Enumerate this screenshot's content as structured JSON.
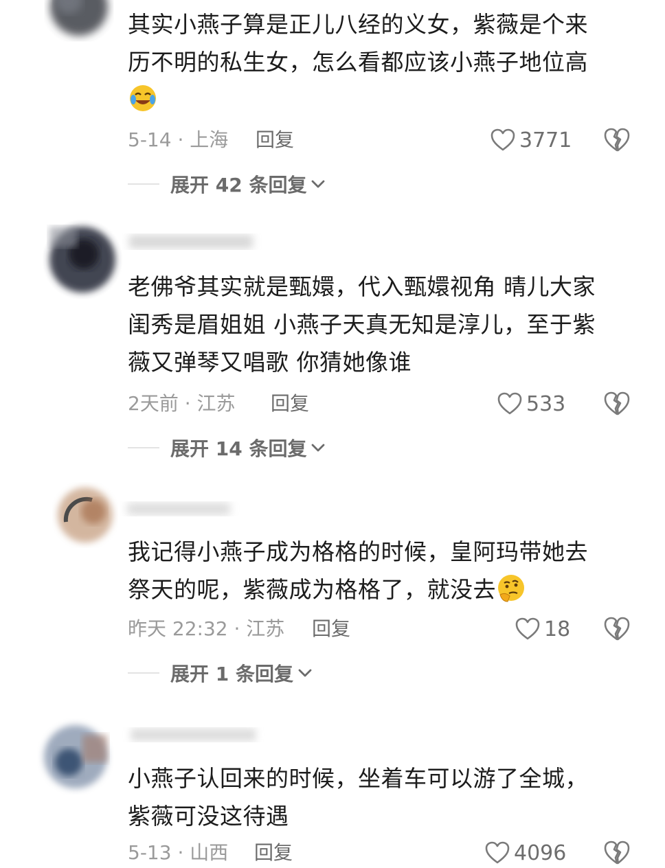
{
  "comments": [
    {
      "lines": [
        "其实小燕子算是正儿八经的义女，紫薇是个来",
        "历不明的私生女，怎么看都应该小燕子地位高"
      ],
      "emoji": "crying-laughing-emoji",
      "meta": "5-14 · 上海",
      "reply": "回复",
      "likes": "3771",
      "expand": "展开 42 条回复"
    },
    {
      "lines": [
        "老佛爷其实就是甄嬛，代入甄嬛视角 晴儿大家",
        "闺秀是眉姐姐 小燕子天真无知是淳儿，至于紫",
        "薇又弹琴又唱歌 你猜她像谁"
      ],
      "meta": "2天前 · 江苏",
      "reply": "回复",
      "likes": "533",
      "expand": "展开 14 条回复"
    },
    {
      "lines": [
        "我记得小燕子成为格格的时候，皇阿玛带她去",
        "祭天的呢，紫薇成为格格了，就没去"
      ],
      "emoji": "thinking-face-emoji",
      "meta": "昨天 22:32 · 江苏",
      "reply": "回复",
      "likes": "18",
      "expand": "展开 1 条回复"
    },
    {
      "lines": [
        "小燕子认回来的时候，坐着车可以游了全城，",
        "紫薇可没这待遇"
      ],
      "meta": "5-13 · 山西",
      "reply": "回复",
      "likes": "4096"
    }
  ],
  "colors": {
    "text": "#1c1c1c",
    "meta": "#9a9a9a",
    "secondary": "#6b6b6b",
    "divider": "#e3e3e3"
  },
  "icons": {
    "like": "heart-outline-icon",
    "dislike": "broken-heart-icon",
    "expand": "chevron-down-icon"
  }
}
